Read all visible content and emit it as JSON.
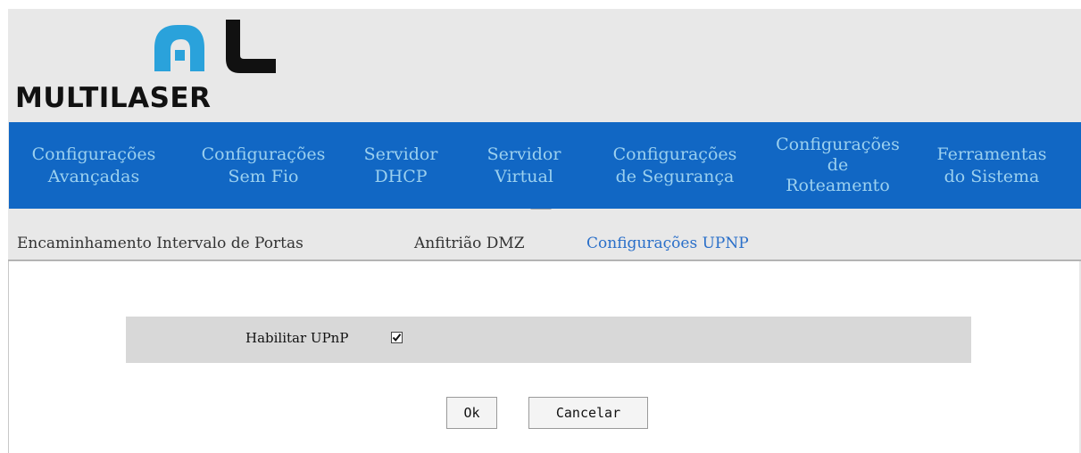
{
  "brand": {
    "name": "MULTILASER"
  },
  "main_nav": {
    "items": [
      {
        "line1": "Configurações",
        "line2": "Avançadas",
        "line3": ""
      },
      {
        "line1": "Configurações",
        "line2": "Sem Fio",
        "line3": ""
      },
      {
        "line1": "Servidor",
        "line2": "DHCP",
        "line3": ""
      },
      {
        "line1": "Servidor",
        "line2": "Virtual",
        "line3": ""
      },
      {
        "line1": "Configurações",
        "line2": "de Segurança",
        "line3": ""
      },
      {
        "line1": "Configurações",
        "line2": "de",
        "line3": "Roteamento"
      },
      {
        "line1": "Ferramentas",
        "line2": "do Sistema",
        "line3": ""
      }
    ],
    "active_index": 3,
    "colors": {
      "bar": "#1167c4",
      "text": "#9bd0ef"
    }
  },
  "sub_nav": {
    "items": [
      {
        "label": "Encaminhamento Intervalo de Portas",
        "active": false
      },
      {
        "label": "Anfitrião DMZ",
        "active": false
      },
      {
        "label": "Configurações UPNP",
        "active": true
      }
    ],
    "active_color": "#2a6fc9"
  },
  "form": {
    "upnp_label": "Habilitar UPnP",
    "upnp_checked": true
  },
  "buttons": {
    "ok": "Ok",
    "cancel": "Cancelar"
  }
}
